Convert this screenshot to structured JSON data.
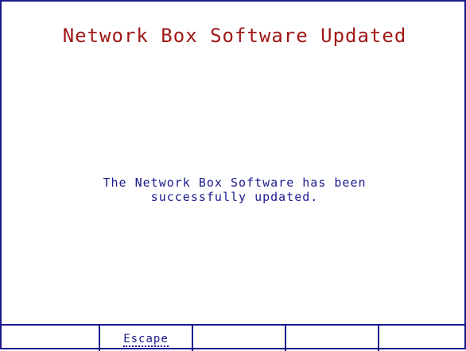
{
  "screen": {
    "title": "Network Box Software Updated",
    "message_lines": [
      "The Network Box Software has been",
      "successfully updated."
    ]
  },
  "softkeys": [
    {
      "label": ""
    },
    {
      "label": "Escape"
    },
    {
      "label": ""
    },
    {
      "label": ""
    },
    {
      "label": ""
    }
  ],
  "colors": {
    "frame": "#1a1a8c",
    "title": "#a01818",
    "text": "#1a1a8c",
    "background": "#ffffff"
  }
}
